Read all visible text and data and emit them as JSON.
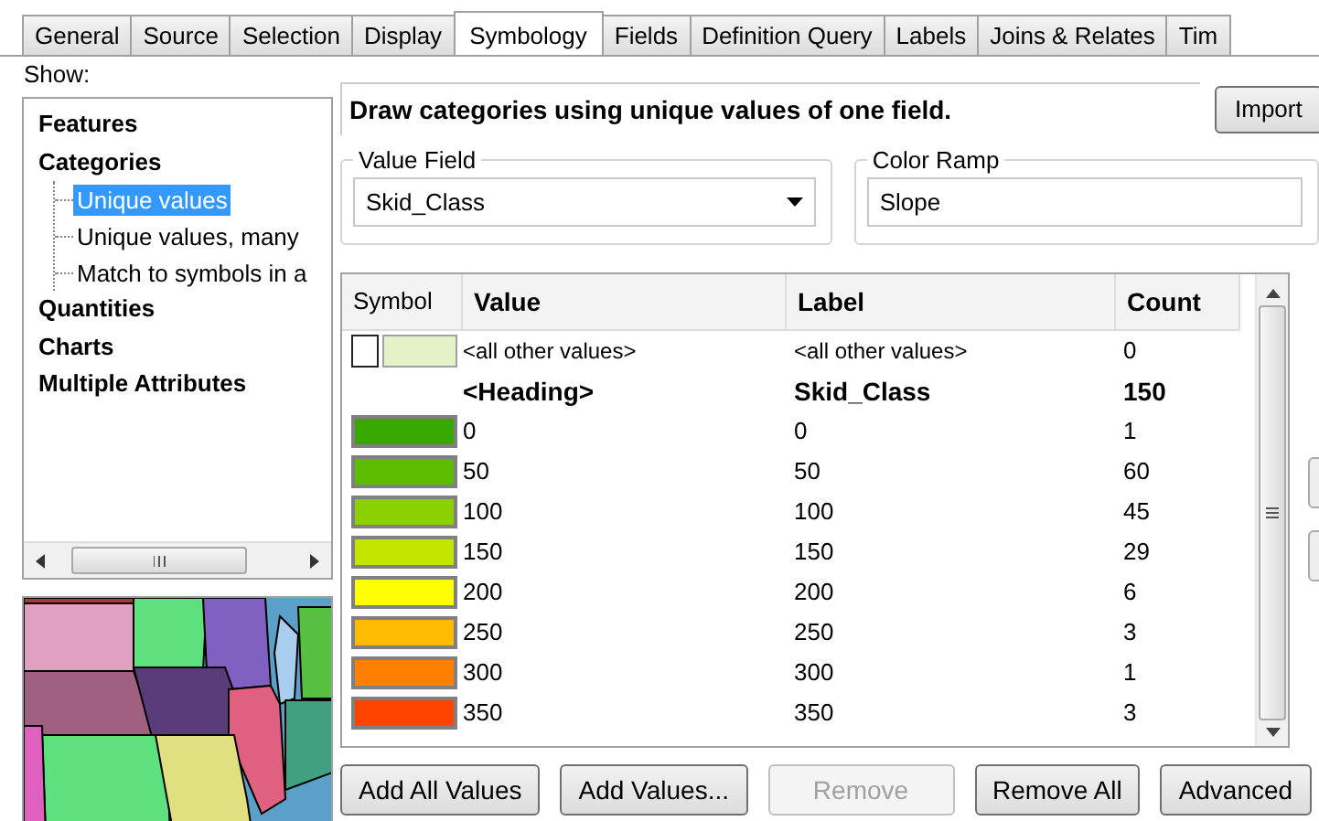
{
  "tabs": [
    {
      "label": "General",
      "selected": false
    },
    {
      "label": "Source",
      "selected": false
    },
    {
      "label": "Selection",
      "selected": false
    },
    {
      "label": "Display",
      "selected": false
    },
    {
      "label": "Symbology",
      "selected": true
    },
    {
      "label": "Fields",
      "selected": false
    },
    {
      "label": "Definition Query",
      "selected": false
    },
    {
      "label": "Labels",
      "selected": false
    },
    {
      "label": "Joins & Relates",
      "selected": false
    },
    {
      "label": "Tim",
      "selected": false
    }
  ],
  "show_label": "Show:",
  "tree": [
    {
      "label": "Features",
      "selected": false
    },
    {
      "label": "Categories",
      "selected": false,
      "children": [
        {
          "label": "Unique values",
          "selected": true
        },
        {
          "label": "Unique values, many",
          "selected": false
        },
        {
          "label": "Match to symbols in a",
          "selected": false
        }
      ]
    },
    {
      "label": "Quantities",
      "selected": false
    },
    {
      "label": "Charts",
      "selected": false
    },
    {
      "label": "Multiple Attributes",
      "selected": false
    }
  ],
  "description": "Draw categories using unique values of one field.",
  "import_button": "Import",
  "value_field": {
    "legend": "Value Field",
    "value": "Skid_Class"
  },
  "color_ramp": {
    "legend": "Color Ramp",
    "value": "Slope"
  },
  "table": {
    "columns": [
      "Symbol",
      "Value",
      "Label",
      "Count"
    ],
    "rows": [
      {
        "kind": "other",
        "value": "<all other values>",
        "label": "<all other values>",
        "count": "0",
        "color": "#e4f2c8"
      },
      {
        "kind": "heading",
        "value": "<Heading>",
        "label": "Skid_Class",
        "count": "150"
      },
      {
        "kind": "value",
        "value": "0",
        "label": "0",
        "count": "1",
        "color": "#38a800"
      },
      {
        "kind": "value",
        "value": "50",
        "label": "50",
        "count": "60",
        "color": "#5cbc00"
      },
      {
        "kind": "value",
        "value": "100",
        "label": "100",
        "count": "45",
        "color": "#8bd100"
      },
      {
        "kind": "value",
        "value": "150",
        "label": "150",
        "count": "29",
        "color": "#c3e600"
      },
      {
        "kind": "value",
        "value": "200",
        "label": "200",
        "count": "6",
        "color": "#ffff00"
      },
      {
        "kind": "value",
        "value": "250",
        "label": "250",
        "count": "3",
        "color": "#ffbb00"
      },
      {
        "kind": "value",
        "value": "300",
        "label": "300",
        "count": "1",
        "color": "#ff8000"
      },
      {
        "kind": "value",
        "value": "350",
        "label": "350",
        "count": "3",
        "color": "#ff4400"
      }
    ]
  },
  "buttons": [
    {
      "label": "Add All Values",
      "disabled": false
    },
    {
      "label": "Add Values...",
      "disabled": false
    },
    {
      "label": "Remove",
      "disabled": true
    },
    {
      "label": "Remove All",
      "disabled": false
    },
    {
      "label": "Advanced",
      "disabled": false
    }
  ]
}
